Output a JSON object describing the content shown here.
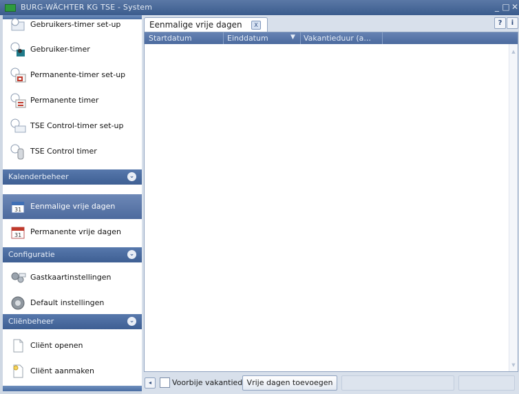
{
  "window": {
    "title": "BURG-WÄCHTER KG TSE - System"
  },
  "sidebar": {
    "items_top": [
      {
        "label": "Gebruikers-timer set-up"
      },
      {
        "label": "Gebruiker-timer"
      },
      {
        "label": "Permanente-timer set-up"
      },
      {
        "label": "Permanente timer"
      },
      {
        "label": "TSE Control-timer set-up"
      },
      {
        "label": "TSE Control timer"
      }
    ],
    "sections": [
      {
        "header": "Kalenderbeheer",
        "items": [
          {
            "label": "Eenmalige vrije dagen",
            "active": true
          },
          {
            "label": "Permanente vrije dagen",
            "active": false
          }
        ]
      },
      {
        "header": "Configuratie",
        "items": [
          {
            "label": "Gastkaartinstellingen"
          },
          {
            "label": "Default instellingen"
          }
        ]
      },
      {
        "header": "Cliënbeheer",
        "items": [
          {
            "label": "Cliënt openen"
          },
          {
            "label": "Cliënt aanmaken"
          }
        ]
      }
    ]
  },
  "main": {
    "tab": {
      "label": "Eenmalige vrije dagen",
      "close": "X"
    },
    "help_buttons": [
      "?",
      "i"
    ],
    "grid": {
      "columns": [
        "Startdatum",
        "Einddatum",
        "Vakantieduur (a..."
      ],
      "rows": []
    },
    "footer": {
      "nav": "◂",
      "checkbox_label": "Voorbije vakantiedagen",
      "checkbox_checked": false,
      "add_button": "Vrije dagen toevoegen"
    }
  },
  "colors": {
    "titlebar": "#3b5c8d",
    "section_header": "#4a6ba0",
    "active_item": "#5a77aa",
    "grid_header": "#5572a5",
    "background": "#d8e0eb"
  }
}
